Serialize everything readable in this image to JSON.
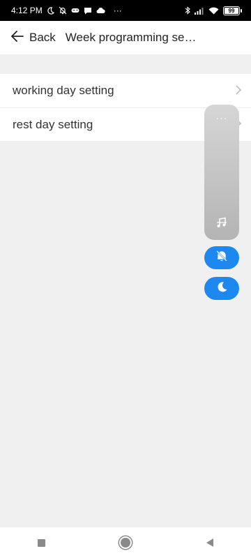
{
  "status_bar": {
    "time": "4:12 PM",
    "more_indicator": "···",
    "battery": "99",
    "battery_level": 0.99,
    "left_icons": [
      "moon-icon",
      "silent-alarm-icon",
      "game-controller-icon",
      "chat-icon",
      "cloud-icon"
    ],
    "right_icons": [
      "bluetooth-icon",
      "signal-icon",
      "wifi-icon",
      "battery-icon"
    ]
  },
  "app_bar": {
    "back_label": "Back",
    "title": "Week programming se…"
  },
  "list": {
    "items": [
      {
        "label": "working day setting",
        "icon": "chevron-right-icon"
      },
      {
        "label": "rest day setting",
        "icon": "chevron-right-icon"
      }
    ]
  },
  "floating_panel": {
    "menu_dots": "···",
    "icons": [
      "music-off-icon",
      "bell-off-icon",
      "moon-icon"
    ],
    "accent_color": "#1d88f0"
  },
  "nav_bar": {
    "icons": [
      "recent-apps-icon",
      "home-icon",
      "back-icon"
    ]
  }
}
